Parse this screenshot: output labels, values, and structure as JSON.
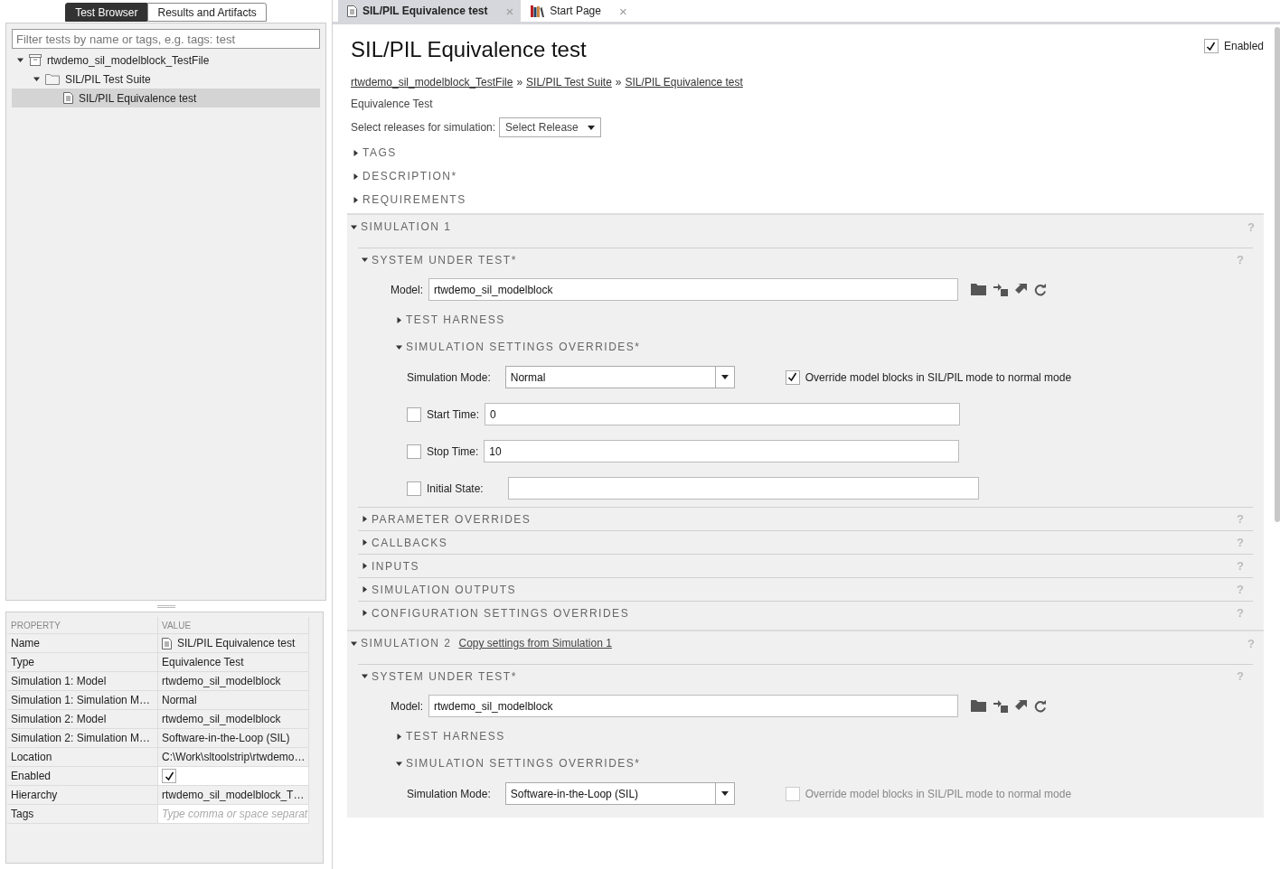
{
  "left_tabs": [
    {
      "label": "Test Browser",
      "selected": true
    },
    {
      "label": "Results and Artifacts",
      "selected": false
    }
  ],
  "filter": {
    "placeholder": "Filter tests by name or tags, e.g. tags: test"
  },
  "tree": [
    {
      "label": "rtwdemo_sil_modelblock_TestFile",
      "kind": "file",
      "expanded": true,
      "selected": false,
      "children": [
        {
          "label": "SIL/PIL Test Suite",
          "kind": "suite",
          "expanded": true,
          "selected": false,
          "children": [
            {
              "label": "SIL/PIL Equivalence test",
              "kind": "test",
              "selected": true
            }
          ]
        }
      ]
    }
  ],
  "properties": {
    "columns": [
      "PROPERTY",
      "VALUE"
    ],
    "rows": [
      {
        "property": "Name",
        "kind": "named",
        "value": "SIL/PIL Equivalence test"
      },
      {
        "property": "Type",
        "kind": "text",
        "value": "Equivalence Test"
      },
      {
        "property": "Simulation 1: Model",
        "kind": "text",
        "value": "rtwdemo_sil_modelblock"
      },
      {
        "property": "Simulation 1: Simulation M…",
        "kind": "text",
        "value": "Normal"
      },
      {
        "property": "Simulation 2: Model",
        "kind": "text",
        "value": "rtwdemo_sil_modelblock"
      },
      {
        "property": "Simulation 2: Simulation M…",
        "kind": "text",
        "value": "Software-in-the-Loop (SIL)"
      },
      {
        "property": "Location",
        "kind": "text",
        "value": "C:\\Work\\sltoolstrip\\rtwdemo…"
      },
      {
        "property": "Enabled",
        "kind": "check",
        "checked": true
      },
      {
        "property": "Hierarchy",
        "kind": "text",
        "value": "rtwdemo_sil_modelblock_T…"
      },
      {
        "property": "Tags",
        "kind": "input",
        "placeholder": "Type comma or space separat"
      }
    ]
  },
  "doc_tabs": [
    {
      "label": "SIL/PIL Equivalence test",
      "kind": "test",
      "selected": true,
      "close": "×"
    },
    {
      "label": "Start Page",
      "kind": "start",
      "selected": false,
      "close": "×"
    }
  ],
  "header": {
    "title": "SIL/PIL Equivalence test",
    "enabled": {
      "label": "Enabled",
      "checked": true
    }
  },
  "breadcrumbs": {
    "links": [
      "rtwdemo_sil_modelblock_TestFile",
      "SIL/PIL Test Suite",
      "SIL/PIL Equivalence test"
    ],
    "separator": "»"
  },
  "test_type": "Equivalence Test",
  "release": {
    "label": "Select releases for simulation:",
    "value": "Select Release"
  },
  "sections": [
    {
      "title": "TAGS",
      "expanded": false
    },
    {
      "title": "DESCRIPTION*",
      "expanded": false
    },
    {
      "title": "REQUIREMENTS",
      "expanded": false
    }
  ],
  "simulations": [
    {
      "title": "SIMULATION 1",
      "expanded": true,
      "help": "?",
      "sut": {
        "title": "SYSTEM UNDER TEST*",
        "expanded": true,
        "help": "?",
        "model_label": "Model:",
        "model": "rtwdemo_sil_modelblock"
      },
      "harness": {
        "title": "TEST HARNESS",
        "expanded": false
      },
      "overrides": {
        "title": "SIMULATION SETTINGS OVERRIDES*",
        "expanded": true,
        "mode_label": "Simulation Mode:",
        "mode": "Normal",
        "override": {
          "label": "Override model blocks in SIL/PIL mode to normal mode",
          "checked": true,
          "disabled": false
        },
        "fields": [
          {
            "label": "Start Time:",
            "value": "0",
            "checked": false
          },
          {
            "label": "Stop Time:",
            "value": "10",
            "checked": false
          },
          {
            "label": "Initial State:",
            "checked": false
          }
        ]
      },
      "subsections": [
        {
          "title": "PARAMETER OVERRIDES",
          "expanded": false,
          "help": "?"
        },
        {
          "title": "CALLBACKS",
          "expanded": false,
          "help": "?"
        },
        {
          "title": "INPUTS",
          "expanded": false,
          "help": "?"
        },
        {
          "title": "SIMULATION OUTPUTS",
          "expanded": false,
          "help": "?"
        },
        {
          "title": "CONFIGURATION SETTINGS OVERRIDES",
          "expanded": false,
          "help": "?"
        }
      ]
    },
    {
      "title": "SIMULATION 2",
      "link": "Copy settings from Simulation 1",
      "expanded": true,
      "help": "?",
      "sut": {
        "title": "SYSTEM UNDER TEST*",
        "expanded": true,
        "help": "?",
        "model_label": "Model:",
        "model": "rtwdemo_sil_modelblock"
      },
      "harness": {
        "title": "TEST HARNESS",
        "expanded": false
      },
      "overrides": {
        "title": "SIMULATION SETTINGS OVERRIDES*",
        "expanded": true,
        "mode_label": "Simulation Mode:",
        "mode": "Software-in-the-Loop (SIL)",
        "override": {
          "label": "Override model blocks in SIL/PIL mode to normal mode",
          "checked": false,
          "disabled": true
        }
      }
    }
  ]
}
